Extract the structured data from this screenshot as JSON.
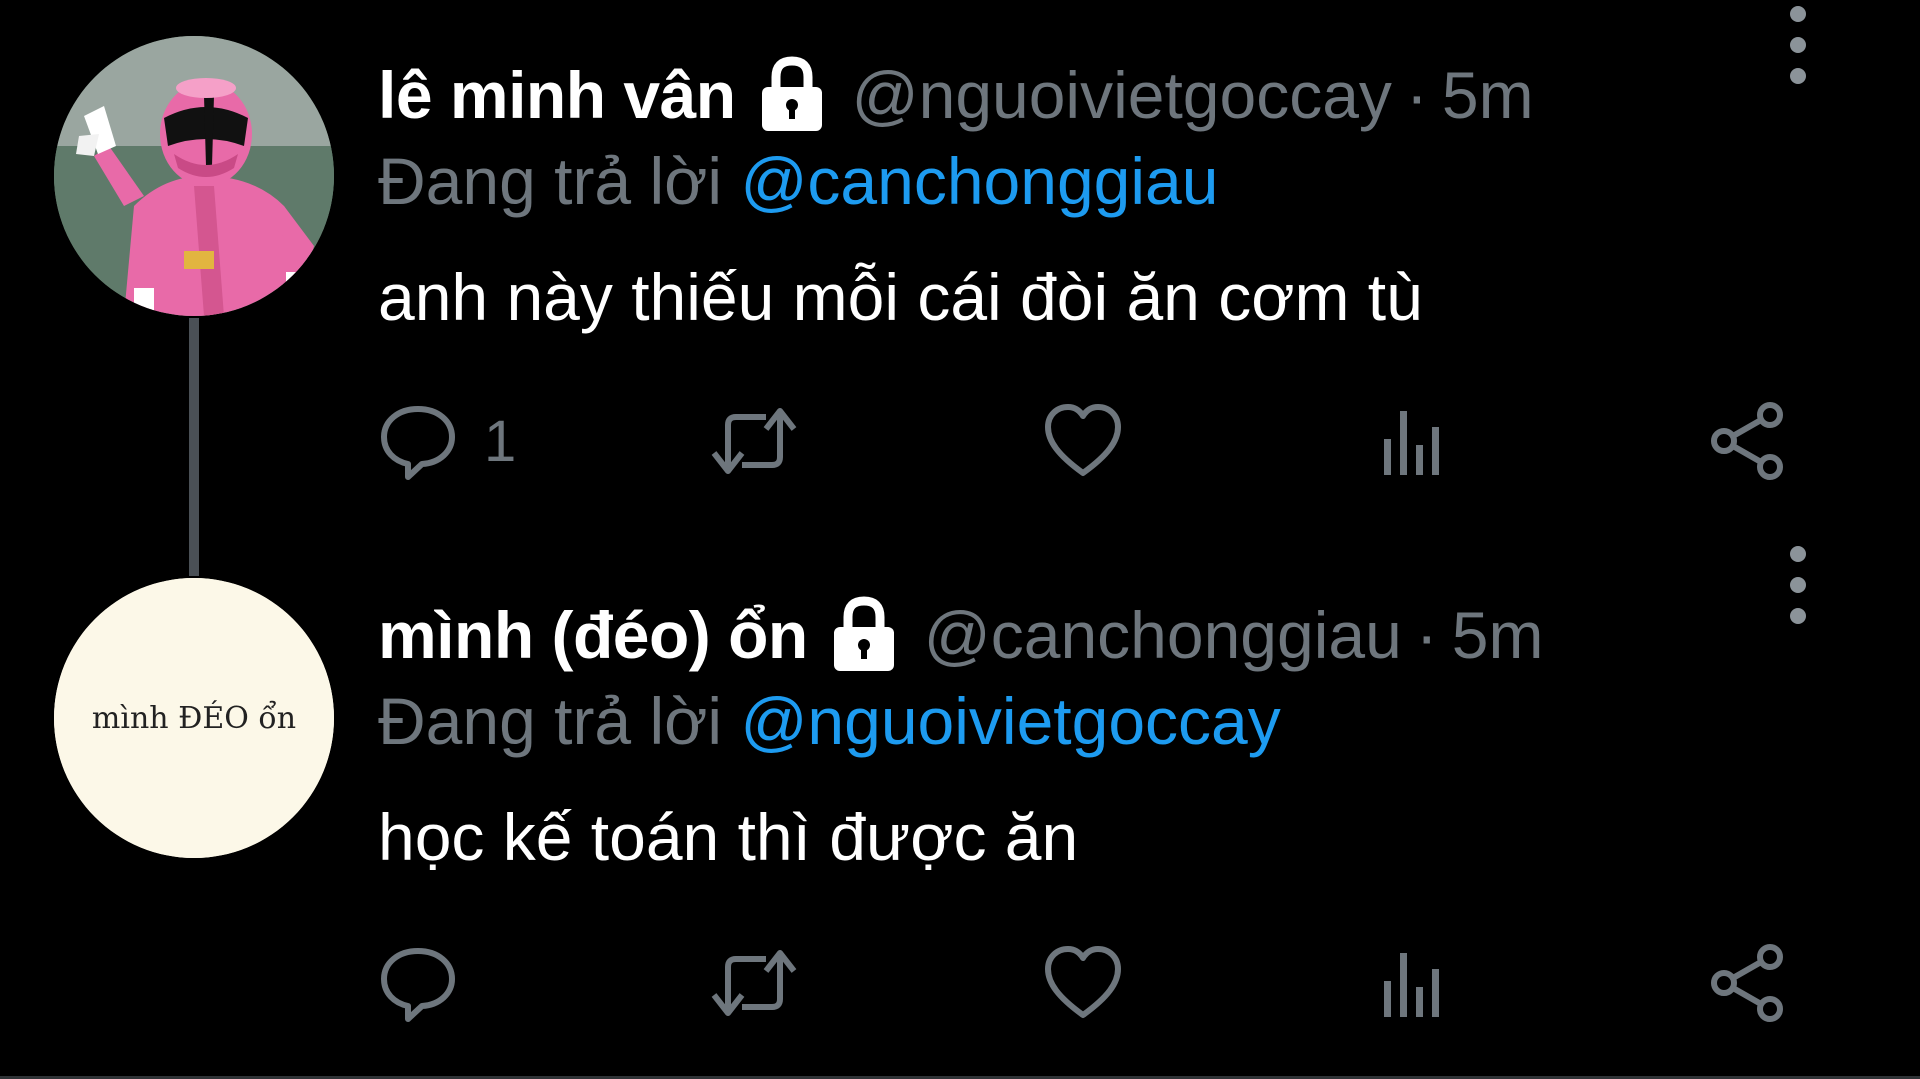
{
  "tweets": [
    {
      "display_name": "lê minh vân",
      "handle": "@nguoivietgoccay",
      "separator": "·",
      "time": "5m",
      "reply_prefix": "Đang trả lời",
      "reply_to": "@canchonggiau",
      "text": "anh này thiếu mỗi cái đòi ăn cơm tù",
      "reply_count": "1",
      "protected": true
    },
    {
      "display_name": "mình (đéo) ổn",
      "handle": "@canchonggiau",
      "separator": "·",
      "time": "5m",
      "reply_prefix": "Đang trả lời",
      "reply_to": "@nguoivietgoccay",
      "text": "học kế toán thì được ăn",
      "reply_count": "",
      "avatar_text": "mình ĐÉO ổn",
      "protected": true
    }
  ],
  "icons": {
    "reply": "speech-bubble-icon",
    "retweet": "retweet-arrows-icon",
    "like": "heart-outline-icon",
    "views": "bar-chart-icon",
    "share": "share-nodes-icon",
    "more": "vertical-ellipsis-icon",
    "lock": "lock-icon"
  },
  "colors": {
    "background": "#000000",
    "primary_text": "#ffffff",
    "secondary_text": "#6e767d",
    "link": "#1d9bf0",
    "thread_line": "#4a5056",
    "avatar2_bg": "#fcf8e8"
  }
}
